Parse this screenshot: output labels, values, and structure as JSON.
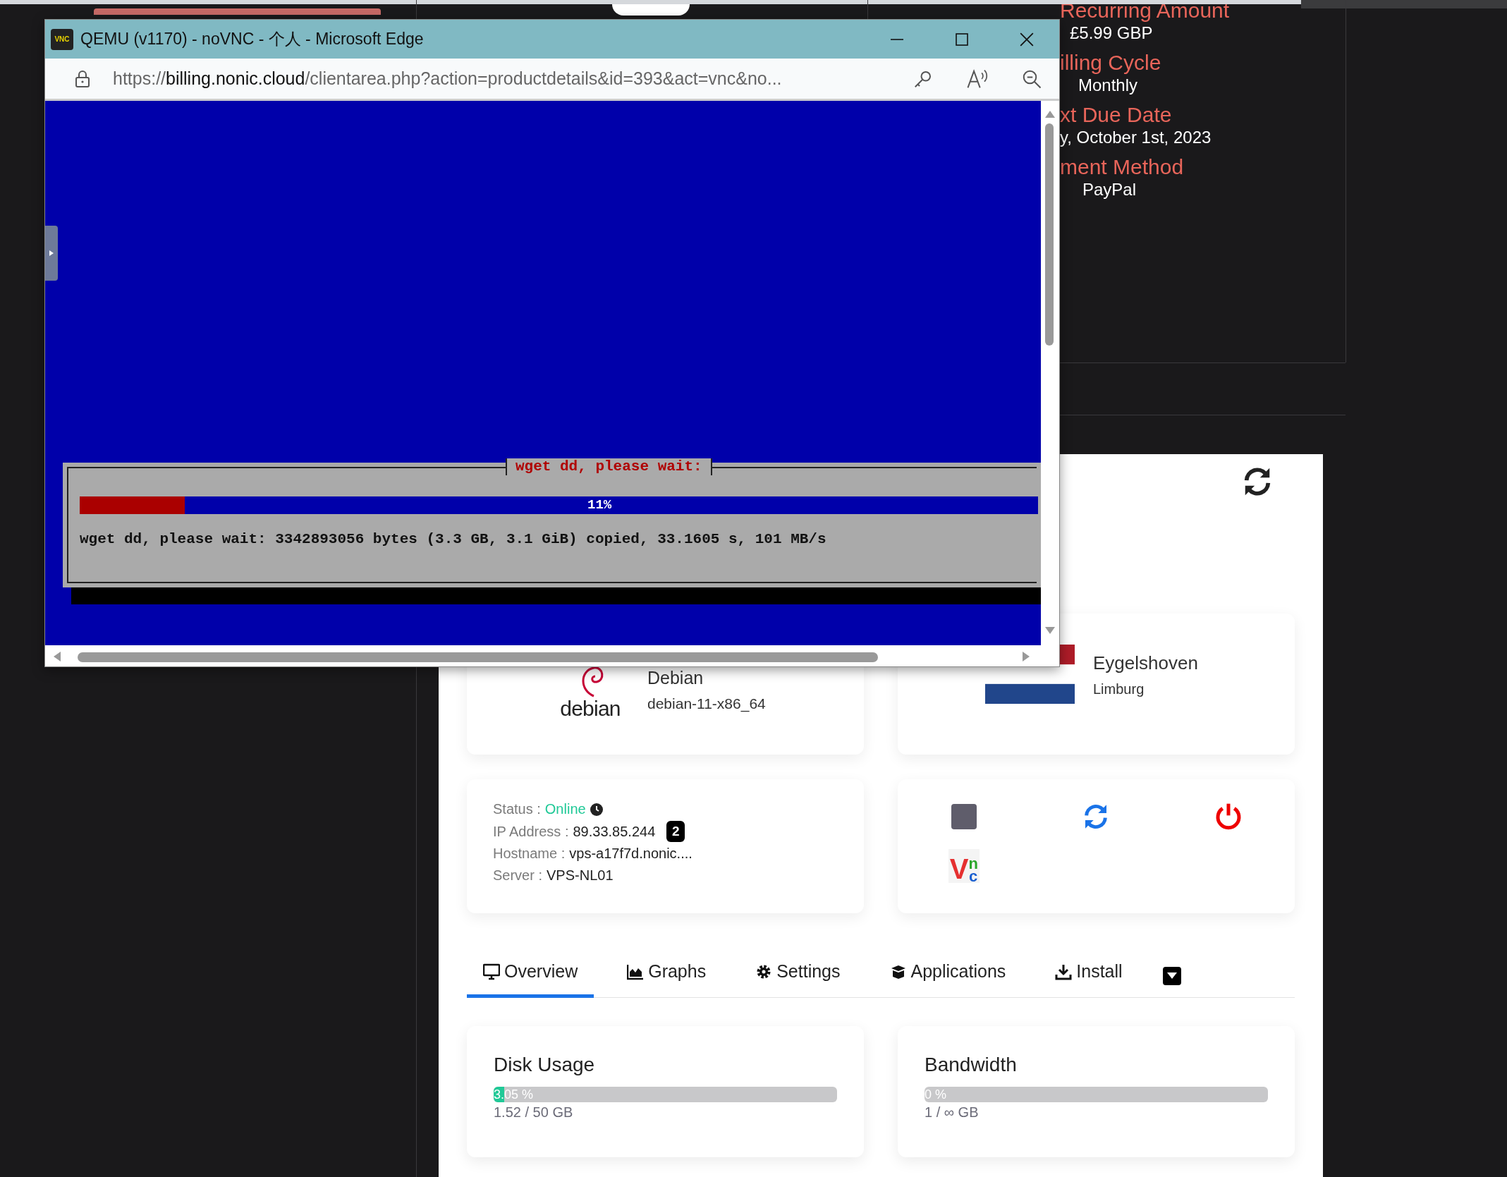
{
  "billing": [
    {
      "label": "Recurring Amount",
      "value": "£5.99 GBP"
    },
    {
      "label": "illing Cycle",
      "value": "Monthly"
    },
    {
      "label": "xt Due Date",
      "value": "y, October 1st, 2023"
    },
    {
      "label": "ment Method",
      "value": "PayPal"
    }
  ],
  "service": {
    "os": {
      "logo_text": "debian",
      "name": "Debian",
      "template": "debian-11-x86_64"
    },
    "location": {
      "city": "Eygelshoven",
      "region": "Limburg"
    },
    "info": [
      {
        "kind": "status",
        "label": "Status :",
        "value": "Online"
      },
      {
        "kind": "ip",
        "label": "IP Address :",
        "value": "89.33.85.244",
        "badge": "2"
      },
      {
        "kind": "text",
        "label": "Hostname :",
        "value": "vps-a17f7d.nonic...."
      },
      {
        "kind": "text",
        "label": "Server :",
        "value": "VPS-NL01"
      }
    ],
    "actions": [
      {
        "kind": "stop"
      },
      {
        "kind": "restart"
      },
      {
        "kind": "power"
      },
      {
        "kind": "vnc",
        "letters": [
          "V",
          "n",
          "c"
        ]
      }
    ],
    "tabs": [
      {
        "label": "Overview",
        "selected": true
      },
      {
        "label": "Graphs",
        "selected": false
      },
      {
        "label": "Settings",
        "selected": false
      },
      {
        "label": "Applications",
        "selected": false
      },
      {
        "label": "Install",
        "selected": false
      }
    ],
    "usage": [
      {
        "title": "Disk Usage",
        "percent": "3.05 %",
        "level": 0.0305,
        "amount": "1.52 / 50 GB"
      },
      {
        "title": "Bandwidth",
        "percent": "0 %",
        "level": 0,
        "amount": "1 / ∞ GB"
      }
    ]
  },
  "window": {
    "title": "QEMU (v1170) - noVNC - 个人 - Microsoft Edge",
    "app_icon_text": "VNC",
    "url_scheme": "https://",
    "url_host": "billing.nonic.cloud",
    "url_path": "/clientarea.php?action=productdetails&id=393&act=vnc&no...",
    "console": {
      "dialog_title": "wget dd, please wait:",
      "progress_label": "11%",
      "level": 0.11,
      "message": "wget dd, please wait: 3342893056 bytes (3.3 GB, 3.1 GiB) copied, 33.1605 s, 101 MB/s"
    }
  }
}
